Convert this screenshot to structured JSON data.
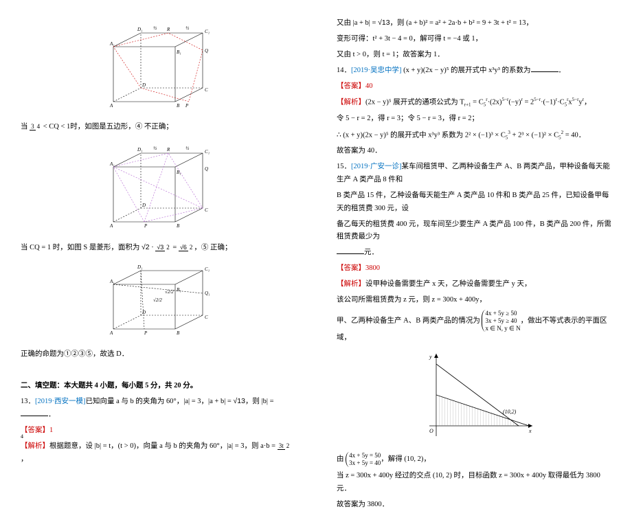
{
  "left": {
    "l1a": "当 ",
    "l1b": " < CQ < 1时，如图是五边形，④ 不正确；",
    "l2a": "当 CQ = 1 时，如图 S 是菱形，面积为 ",
    "l2b": "，⑤ 正确；",
    "l3": "正确的命题为①②③⑤，故选 D．",
    "sec": "二、填空题：本大题共  4 小题，每小题  5 分，共 20 分。",
    "l4a": "13．",
    "l4s": "[2019·西安一模]",
    "l4b": "已知向量 a 与 b 的夹角为 60°，|a| = 3，|a + b| = ",
    "l4c": "，则 |b| = ",
    "l4d": "．",
    "l5": "【答案】1",
    "l6a": "【解析】",
    "l6b": "根据题意，设 |b| = t，(t > 0)，向量 a 与 b 的夹角为 60°，|a| = 3，则 a·b = ",
    "l6c": "，",
    "fr1": {
      "n": "3",
      "d": "4"
    },
    "fr2a": {
      "n": "√3",
      "d": "2"
    },
    "fr2b": {
      "n": "√6",
      "d": "2"
    },
    "fr3": {
      "n": "3t",
      "d": "2"
    },
    "sqrt2": "√2",
    "sqrt13": "√13",
    "cube1": {
      "D1": "D₁",
      "R": "R",
      "C1": "C₁",
      "A1": "A₁",
      "B1": "B₁",
      "Q": "Q",
      "D": "D",
      "C": "C",
      "A": "A",
      "B": "B",
      "P": "P",
      "half": "½"
    },
    "cube2": {
      "D1": "D₁",
      "R": "R",
      "C1": "C₁",
      "A1": "A₁",
      "B1": "B₁",
      "Q": "Q",
      "D": "D",
      "C": "C",
      "A": "A",
      "B": "B",
      "P": "P",
      "half": "½"
    },
    "cube3": {
      "D1": "D₁",
      "C1": "C₁",
      "A1": "A₁",
      "B1": "B₁",
      "Q1": "Q₁",
      "D": "D",
      "C": "C",
      "A": "A",
      "B": "B",
      "P": "P",
      "s": "√2/2"
    }
  },
  "right": {
    "r1a": "又由 |a + b| = ",
    "r1b": "，则 (a + b)² = a² + 2a·b + b² = 9 + 3t + t² = 13，",
    "r2": "变形可得：t² + 3t − 4 = 0，解可得 t = −4 或 1，",
    "r3": "又由 t > 0，则 t = 1；故答案为 1．",
    "r4a": "14．",
    "r4s": "[2019·吴忠中学]",
    "r4b": " (x + y)(2x − y)⁵ 的展开式中 x³y³ 的系数为",
    "r4c": "．",
    "r5": "【答案】40",
    "r6a": "【解析】",
    "r6b": "(2x − y)⁵ 展开式的通项公式为 T",
    "r6c": " = C",
    "r6d": "·(2x)",
    "r6e": "(−y)",
    "r6f": " = 2",
    "r6g": "·(−1)",
    "r6h": "·C",
    "r6i": "x",
    "r6j": "y",
    "r6k": "，",
    "r7": "令 5 − r = 2，得 r = 3；令 5 − r = 3，得 r = 2；",
    "r8a": "∴ (x + y)(2x − y)⁵ 的展开式中 x³y³ 系数为 2² × (−1)³ × C",
    "r8b": " + 2³ × (−1)² × C",
    "r8c": " = 40．",
    "r9": "故答案为 40．",
    "r10a": "15．",
    "r10s": "[2019·广安一诊]",
    "r10b": "某车间租赁甲、乙两种设备生产 A、B 两类产品，甲种设备每天能生产 A 类产品 8 件和",
    "r10c": "B 类产品 15 件，乙种设备每天能生产 A 类产品 10 件和 B 类产品 25 件，已知设备甲每天的租赁费 300 元，设",
    "r10d": "备乙每天的租赁费 400 元，现车间至少要生产 A 类产品 100 件，B 类产品 200 件，所需租赁费最少为",
    "r10e": "元．",
    "r11": "【答案】3800",
    "r12a": "【解析】",
    "r12b": "设甲种设备需要生产 x 天，乙种设备需要生产 y 天，",
    "r13": "该公司所需租赁费为 z 元，则 z = 300x + 400y，",
    "r14a": "甲、乙两种设备生产 A、B 两类产品的情况为 ",
    "r14b": "，做出不等式表示的平面区域，",
    "r15a": "由 ",
    "r15b": "，解得 (10, 2)，",
    "r16": "当 z = 300x + 400y 经过的交点 (10, 2) 时，目标函数 z = 300x + 400y 取得最低为 3800 元．",
    "r17": "故答案为 3800．",
    "sqrt13": "√13",
    "case1": {
      "a": "4x + 5y ≥ 50",
      "b": "3x + 5y ≥ 40",
      "c": "x ∈ N, y ∈ N"
    },
    "case2": {
      "a": "4x + 5y = 50",
      "b": "3x + 5y = 40"
    },
    "chart": {
      "pt": "(10,2)",
      "x": "x",
      "y": "y",
      "O": "O"
    }
  },
  "pgnum": "4",
  "chart_data": {
    "type": "lp-region",
    "constraints": [
      "4x+5y>=50",
      "3x+5y>=40",
      "x>=0",
      "y>=0"
    ],
    "feasible_vertex": [
      10,
      2
    ],
    "objective": "300x+400y",
    "min_value": 3800,
    "xrange": [
      0,
      14
    ],
    "yrange": [
      -1,
      11
    ]
  }
}
